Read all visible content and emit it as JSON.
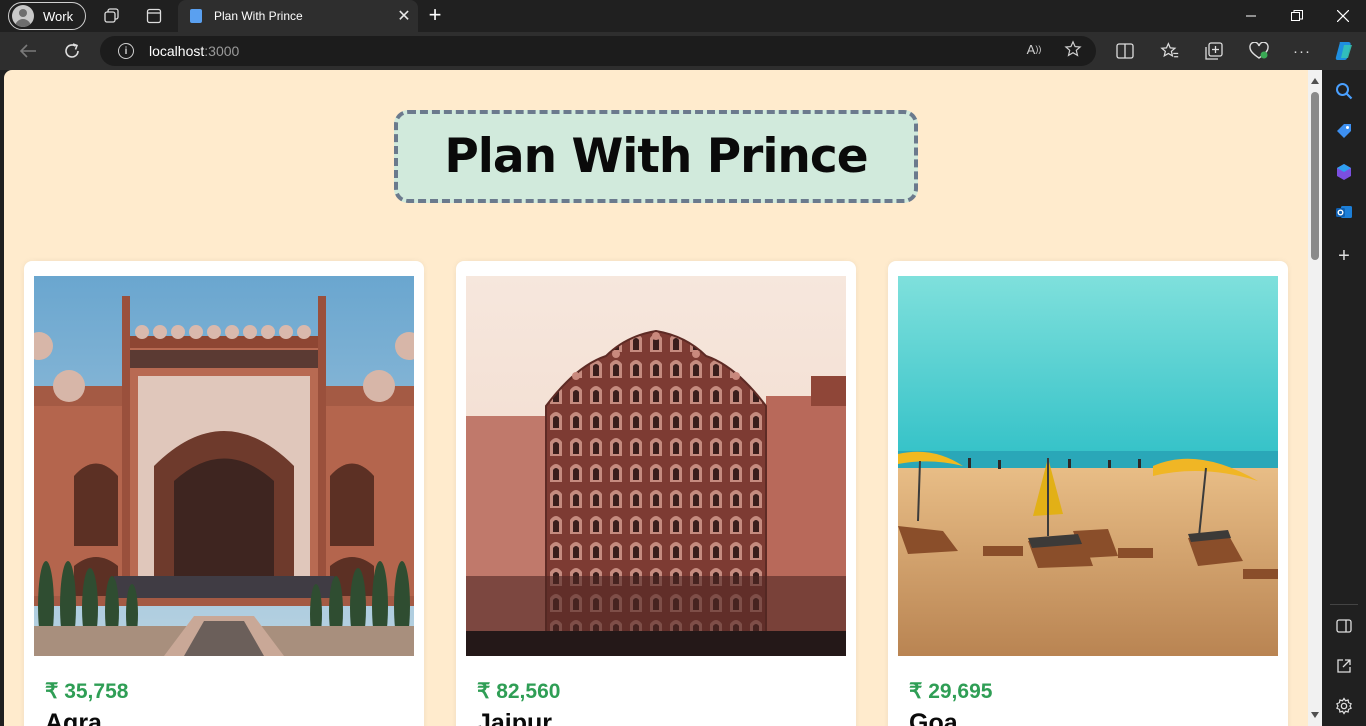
{
  "browser": {
    "profile_label": "Work",
    "tab_title": "Plan With Prince",
    "url_host": "localhost",
    "url_port": ":3000"
  },
  "page": {
    "heading": "Plan With Prince",
    "tours": [
      {
        "price": "₹ 35,758",
        "city": "Agra"
      },
      {
        "price": "₹ 82,560",
        "city": "Jaipur"
      },
      {
        "price": "₹ 29,695",
        "city": "Goa"
      }
    ]
  },
  "colors": {
    "page_background": "#ffebcd",
    "heading_box_background": "#d1eadc",
    "heading_box_border": "#6b7a8d",
    "price_text": "#2f9e55"
  }
}
